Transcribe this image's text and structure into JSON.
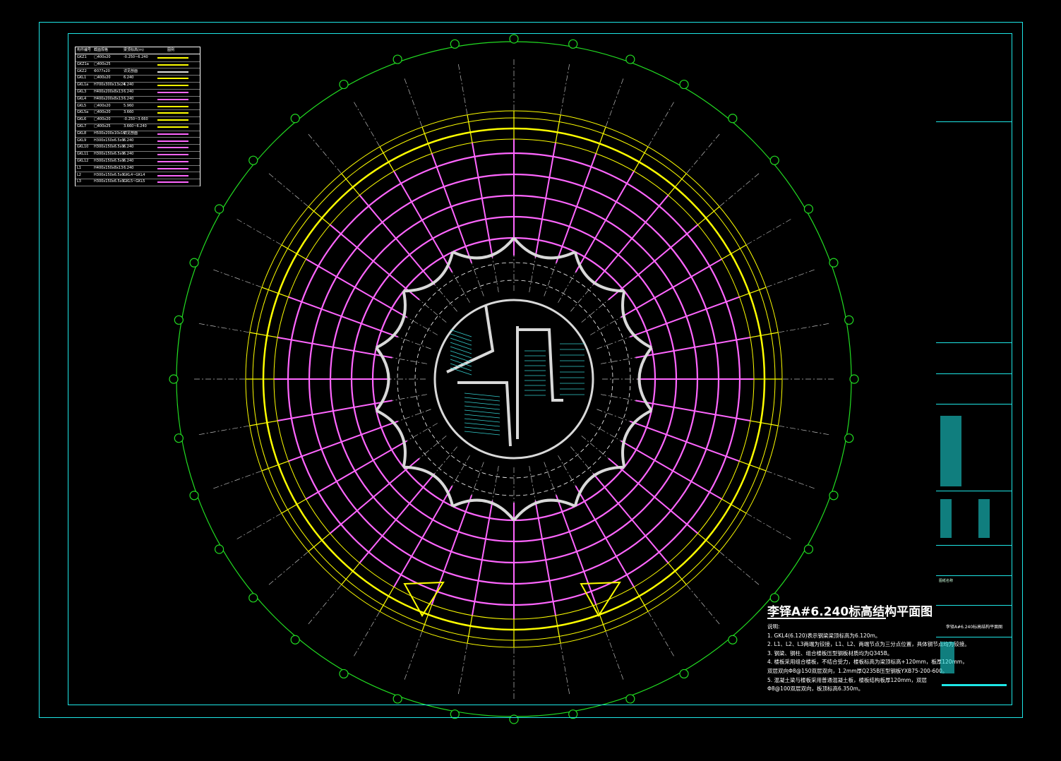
{
  "drawing": {
    "title": "李铎A#6.240标高结构平面图",
    "notes_heading": "说明:",
    "notes": [
      "1. GKL4(6.120)表示钢梁梁顶标高为6.120m。",
      "2. L1、L2、L3两端为铰接，L1、L2、两端节点为三分点位置，具体钢节点均为铰接。",
      "3. 钢梁、钢柱、组合楼板压型钢板材质均为Q345B。",
      "4. 楼板采用组合楼板，不结合受力，楼板标高为梁顶标高+120mm，板厚120mm，",
      "   双层双向Φ8@150双层双向，1.2mm厚Q235B压型钢板YXB75-200-600。",
      "5. 混凝土梁与楼板采用普通混凝土板，楼板结构板厚120mm，双层",
      "   Φ8@100双层双向，板顶标高6.350m。"
    ],
    "colors": {
      "frame": "#1ee6e6",
      "grid_ring": "#22dd22",
      "radial_axis": "#ffffff",
      "outer_beam": "#ffff00",
      "steel_beam": "#ff66ff",
      "core_wall": "#d9d9d9",
      "stair": "#33cccc"
    }
  },
  "legend": {
    "headers": [
      "构件编号",
      "截面规格",
      "梁顶标高(m)",
      "图例"
    ],
    "rows": [
      {
        "id": "GKZ1",
        "size": "□400x20",
        "elev": "-0.250~6.240",
        "color": "#ffff00"
      },
      {
        "id": "GKZ1a",
        "size": "□400x25",
        "elev": "",
        "color": "#ffff00"
      },
      {
        "id": "GKZ2",
        "size": "Φ377x20",
        "elev": "详见剖面",
        "color": "#dddddd"
      },
      {
        "id": "GKL1",
        "size": "□400x20",
        "elev": "6.240",
        "color": "#ffff00"
      },
      {
        "id": "GKL1a",
        "size": "H700x300x13x24",
        "elev": "6.240",
        "color": "#ffff00"
      },
      {
        "id": "GKL3",
        "size": "H400x200x8x13",
        "elev": "6.240",
        "color": "#ff66ff"
      },
      {
        "id": "GKL4",
        "size": "H400x200x8x13",
        "elev": "6.240",
        "color": "#ff66ff"
      },
      {
        "id": "GKL5",
        "size": "□400x20",
        "elev": "5.960",
        "color": "#ffff00"
      },
      {
        "id": "GKL5a",
        "size": "□400x20",
        "elev": "3.660",
        "color": "#ffff00"
      },
      {
        "id": "GKL6",
        "size": "□400x20",
        "elev": "-0.250~3.660",
        "color": "#ffff00"
      },
      {
        "id": "GKL7",
        "size": "□400x25",
        "elev": "3.660~6.240",
        "color": "#ffff00"
      },
      {
        "id": "GKL8",
        "size": "H500x200x10x16",
        "elev": "详见剖面",
        "color": "#ff66ff"
      },
      {
        "id": "GKL9",
        "size": "H300x150x6.5x9",
        "elev": "6.240",
        "color": "#ff66ff"
      },
      {
        "id": "GKL10",
        "size": "H300x150x6.5x9",
        "elev": "6.240",
        "color": "#ff66ff"
      },
      {
        "id": "GKL11",
        "size": "H300x150x6.5x9",
        "elev": "6.240",
        "color": "#ff66ff"
      },
      {
        "id": "GKL12",
        "size": "H300x150x6.5x9",
        "elev": "6.240",
        "color": "#ff66ff"
      },
      {
        "id": "L1",
        "size": "H400x150x8x13",
        "elev": "6.240",
        "color": "#ff66ff"
      },
      {
        "id": "L2",
        "size": "H300x150x6.5x9",
        "elev": "GKL4~GKL4",
        "color": "#ff66ff"
      },
      {
        "id": "L3",
        "size": "H300x150x6.5x9",
        "elev": "GKL5~GKL5",
        "color": "#ff66ff"
      }
    ]
  },
  "titleblock": {
    "drawing_name_label": "图纸名称",
    "drawing_name": "李铎A#6.240标高结构平面图"
  }
}
